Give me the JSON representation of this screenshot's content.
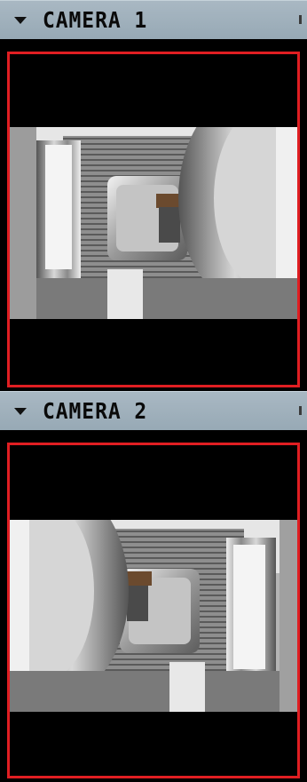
{
  "cameras": [
    {
      "title": "CAMERA 1",
      "header_icon": "caret-down-icon",
      "feed": "cnc-machining-feed",
      "border_color": "#e01e22"
    },
    {
      "title": "CAMERA 2",
      "header_icon": "caret-down-icon",
      "feed": "cnc-machining-feed",
      "border_color": "#e01e22"
    }
  ],
  "colors": {
    "header_bg": "#a3b3bf",
    "viewport_border": "#e01e22",
    "background": "#000000"
  }
}
